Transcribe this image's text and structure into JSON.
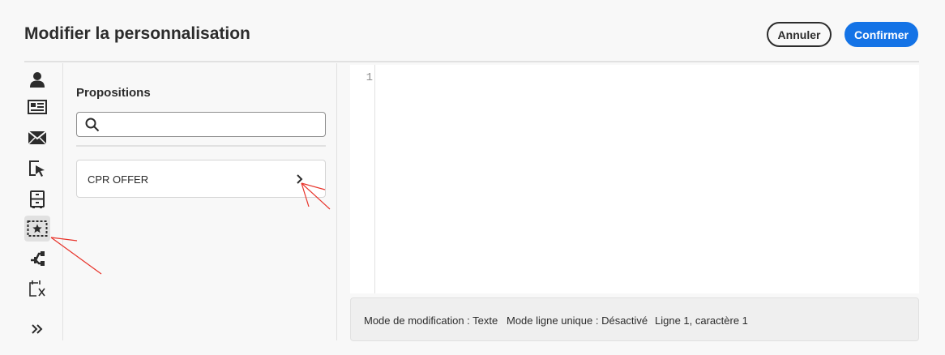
{
  "dialog": {
    "title": "Modifier la personnalisation",
    "cancel_label": "Annuler",
    "confirm_label": "Confirmer"
  },
  "rail": {
    "items": [
      {
        "icon": "user-icon"
      },
      {
        "icon": "newspaper-icon"
      },
      {
        "icon": "email-icon"
      },
      {
        "icon": "cursor-select-icon"
      },
      {
        "icon": "file-cabinet-icon"
      },
      {
        "icon": "offer-star-icon",
        "selected": true
      },
      {
        "icon": "git-branch-icon"
      },
      {
        "icon": "calendar-function-icon"
      }
    ],
    "expand_icon": "double-chevron-right-icon"
  },
  "propositions": {
    "title": "Propositions",
    "search": {
      "value": "",
      "placeholder": ""
    },
    "offers": [
      {
        "label": "CPR OFFER"
      }
    ]
  },
  "editor": {
    "line_numbers": [
      "1"
    ]
  },
  "statusbar": {
    "edit_mode": "Mode de modification : Texte",
    "single_line_mode": "Mode ligne unique : Désactivé",
    "position": "Ligne 1, caractère 1"
  },
  "colors": {
    "accent": "#1473e6",
    "background": "#f8f8f8",
    "annotation": "#e8332a"
  }
}
